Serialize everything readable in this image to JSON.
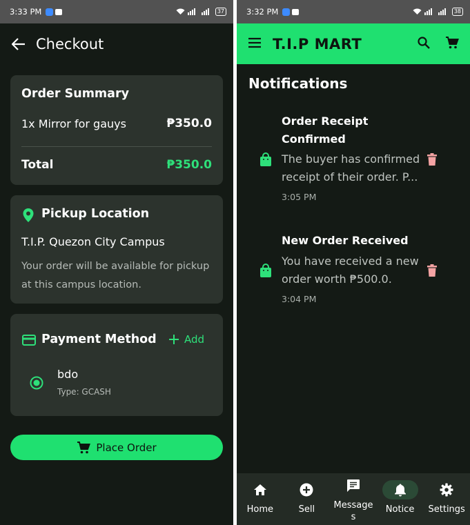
{
  "left": {
    "status_time": "3:33 PM",
    "battery": "37",
    "header_title": "Checkout",
    "order_summary": {
      "title": "Order Summary",
      "item_label": "1x Mirror for gauys",
      "item_price": "₱350.0",
      "total_label": "Total",
      "total_value": "₱350.0"
    },
    "pickup": {
      "title": "Pickup Location",
      "campus": "T.I.P. Quezon City Campus",
      "note": "Your order will be available for pickup at this campus location."
    },
    "payment": {
      "title": "Payment Method",
      "add_label": "Add",
      "method_name": "bdo",
      "method_type": "Type: GCASH"
    },
    "place_order_label": "Place Order"
  },
  "right": {
    "status_time": "3:32 PM",
    "battery": "38",
    "app_title": "T.I.P MART",
    "section_title": "Notifications",
    "notifications": [
      {
        "title": "Order Receipt Confirmed",
        "body": "The buyer has confirmed receipt of their order. P...",
        "time": "3:05 PM"
      },
      {
        "title": "New Order Received",
        "body": "You have received a new order worth ₱500.0.",
        "time": "3:04 PM"
      }
    ],
    "nav": [
      {
        "label": "Home",
        "icon": "home-icon"
      },
      {
        "label": "Sell",
        "icon": "add-circle-icon"
      },
      {
        "label": "Messages",
        "icon": "message-icon"
      },
      {
        "label": "Notice",
        "icon": "bell-icon"
      },
      {
        "label": "Settings",
        "icon": "gear-icon"
      }
    ],
    "active_nav": "Notice"
  },
  "colors": {
    "accent": "#1fe070",
    "background": "#141a15",
    "card": "#2c332d",
    "delete": "#f4a3a3"
  }
}
